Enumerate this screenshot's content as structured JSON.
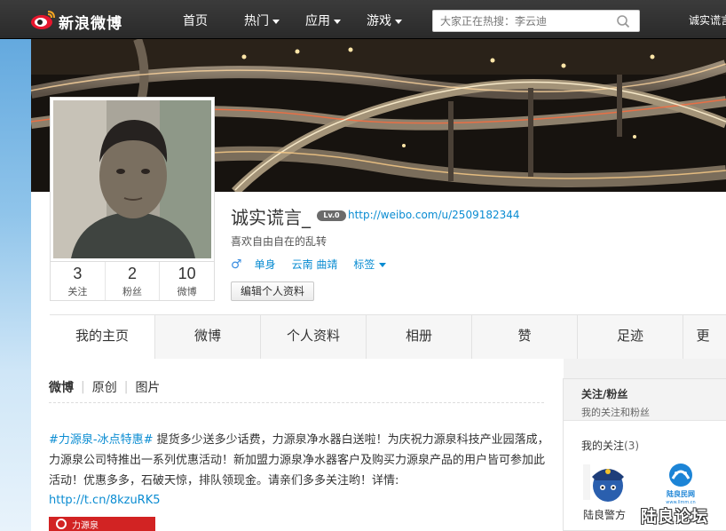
{
  "nav": {
    "logo_text": "新浪微博",
    "items": [
      {
        "label": "首页",
        "has_dropdown": false
      },
      {
        "label": "热门",
        "has_dropdown": true
      },
      {
        "label": "应用",
        "has_dropdown": true
      },
      {
        "label": "游戏",
        "has_dropdown": true
      }
    ],
    "search_placeholder": "大家正在热搜：李云迪",
    "user_name": "诚实谎言"
  },
  "profile": {
    "nickname": "诚实谎言_",
    "level_badge": "Lv.0",
    "url": "http://weibo.com/u/2509182344",
    "bio": "喜欢自由自在的乱转",
    "gender_icon": "male-icon",
    "gender_symbol": "♂",
    "relationship": "单身",
    "location": "云南 曲靖",
    "tags_label": "标签",
    "edit_button": "编辑个人资料",
    "stats": [
      {
        "num": "3",
        "label": "关注"
      },
      {
        "num": "2",
        "label": "粉丝"
      },
      {
        "num": "10",
        "label": "微博"
      }
    ]
  },
  "tabs": [
    "我的主页",
    "微博",
    "个人资料",
    "相册",
    "赞",
    "足迹",
    "更"
  ],
  "feed": {
    "subtabs": [
      "微博",
      "原创",
      "图片"
    ],
    "post": {
      "topic": "#力源泉-冰点特惠#",
      "text": " 提货多少送多少话费，力源泉净水器白送啦！为庆祝力源泉科技产业园落成，力源泉公司特推出一系列优惠活动！新加盟力源泉净水器客户及购买力源泉产品的用户皆可参加此活动！优惠多多，石破天惊，排队领现金。请亲们多多关注哟！详情:",
      "link": "http://t.cn/8kzuRK5",
      "thumb_text": "力源泉"
    }
  },
  "sidebar": {
    "title": "关注/粉丝",
    "subtitle": "我的关注和粉丝",
    "follow_label": "我的关注",
    "follow_count": "(3)",
    "follows": [
      {
        "name": "陆良警方"
      },
      {
        "name": ""
      }
    ],
    "logo_caption": "陆良民网",
    "logo_url": "www.llmm.cn"
  },
  "watermark": "陆良论坛",
  "colors": {
    "nav_bg": "#2d2d2d",
    "link": "#0a8cd2",
    "accent_red": "#d22323"
  }
}
